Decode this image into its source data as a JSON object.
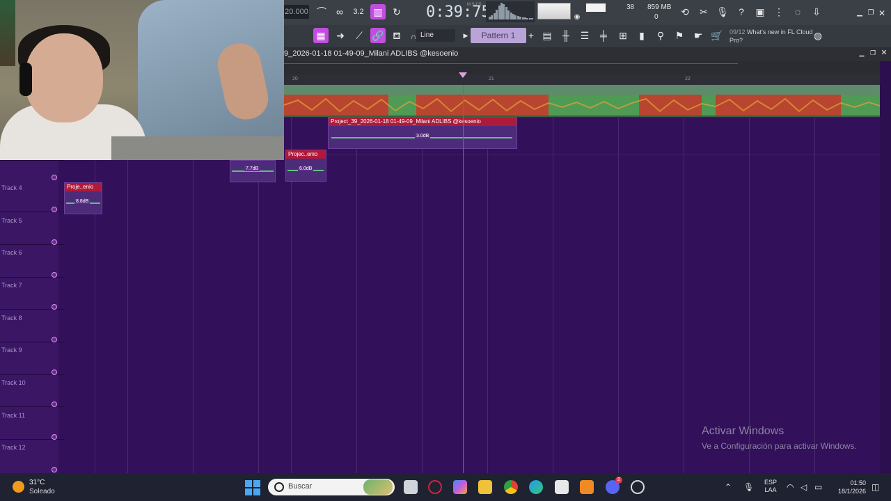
{
  "toolbar": {
    "bpm": "20.000",
    "time": "0:39:75",
    "time_unit_label": "M:S:CS",
    "cpu_value": "38",
    "memory": "859 MB",
    "polyphony": "0",
    "line_mode": "Line",
    "pattern": "Pattern 1",
    "news_date": "09/12",
    "news_text": "What's new in FL Cloud Pro?"
  },
  "playlist": {
    "title": "9_2026-01-18 01-49-09_Milani ADLIBS @kesoenio",
    "ruler": [
      "20",
      "21",
      "22"
    ],
    "tracks": [
      "Track 4",
      "Track 5",
      "Track 6",
      "Track 7",
      "Track 8",
      "Track 9",
      "Track 10",
      "Track 11",
      "Track 12"
    ],
    "clips": [
      {
        "name": "Project_39_2026-01-18 01-49-09_Milani ADLIBS @kesoenio",
        "gain": "3.0dB"
      },
      {
        "name": "Projec..enio",
        "gain": "6.0dB"
      },
      {
        "name": "",
        "gain": "7.7dB"
      },
      {
        "name": "Proje..enio",
        "gain": "8.8dB"
      }
    ]
  },
  "watermark": {
    "title": "Activar Windows",
    "subtitle": "Ve a Configuración para activar Windows."
  },
  "taskbar": {
    "temp": "31°C",
    "weather": "Soleado",
    "search_placeholder": "Buscar",
    "lang_1": "ESP",
    "lang_2": "LAA",
    "time": "01:50",
    "date": "18/1/2026",
    "discord_badge": "2"
  }
}
